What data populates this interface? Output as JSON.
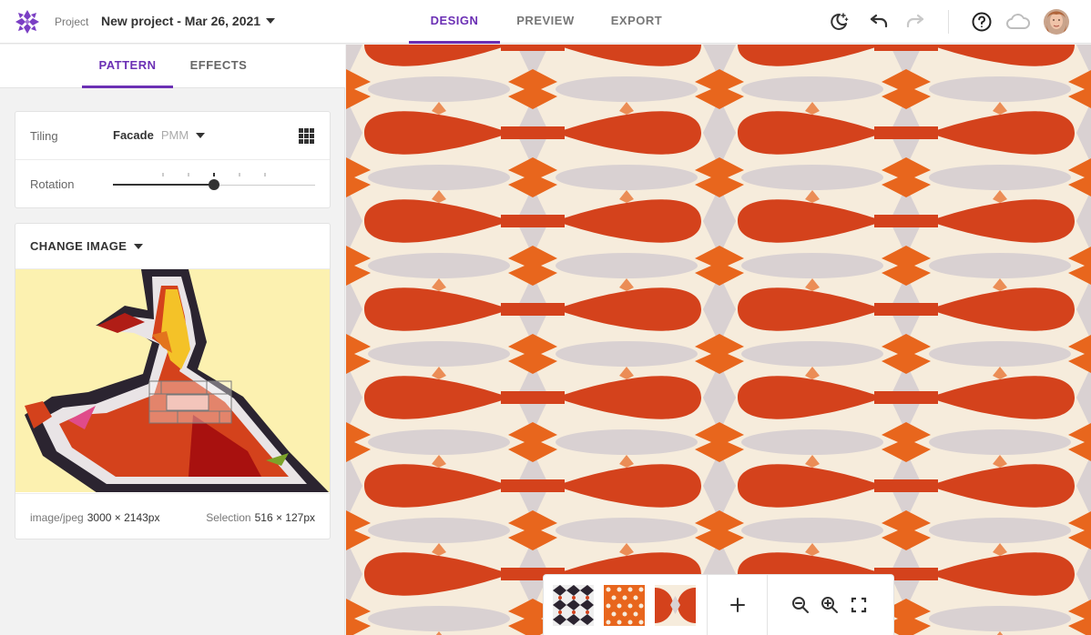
{
  "header": {
    "project_label": "Project",
    "project_name": "New project - Mar 26, 2021",
    "tabs": [
      {
        "label": "DESIGN",
        "active": true
      },
      {
        "label": "PREVIEW",
        "active": false
      },
      {
        "label": "EXPORT",
        "active": false
      }
    ],
    "icons": [
      "night-mode-icon",
      "undo-icon",
      "redo-icon",
      "help-icon",
      "cloud-icon"
    ]
  },
  "sidebar": {
    "tabs": [
      {
        "label": "PATTERN",
        "active": true
      },
      {
        "label": "EFFECTS",
        "active": false
      }
    ],
    "tiling": {
      "label": "Tiling",
      "name": "Facade",
      "code": "PMM"
    },
    "rotation": {
      "label": "Rotation",
      "value": 0.5
    },
    "change_image_label": "CHANGE IMAGE",
    "image_meta": {
      "type": "image/jpeg",
      "dimensions": "3000 × 2143px",
      "selection_label": "Selection",
      "selection_size": "516 × 127px"
    }
  },
  "colors": {
    "accent": "#6b2fb4",
    "pattern_red": "#d4421c",
    "pattern_orange": "#e8661d",
    "pattern_cream": "#f6ecdc",
    "pattern_grey": "#d9d1d2"
  }
}
